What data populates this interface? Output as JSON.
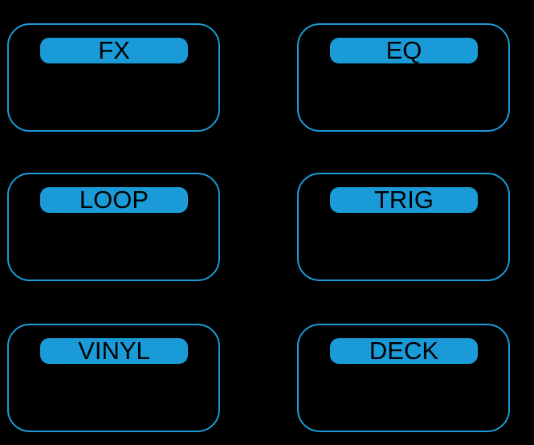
{
  "pads": [
    {
      "label": "FX"
    },
    {
      "label": "EQ"
    },
    {
      "label": "LOOP"
    },
    {
      "label": "TRIG"
    },
    {
      "label": "VINYL"
    },
    {
      "label": "DECK"
    }
  ],
  "colors": {
    "background": "#000000",
    "accent": "#1a9bd7",
    "label_text": "#000000"
  }
}
